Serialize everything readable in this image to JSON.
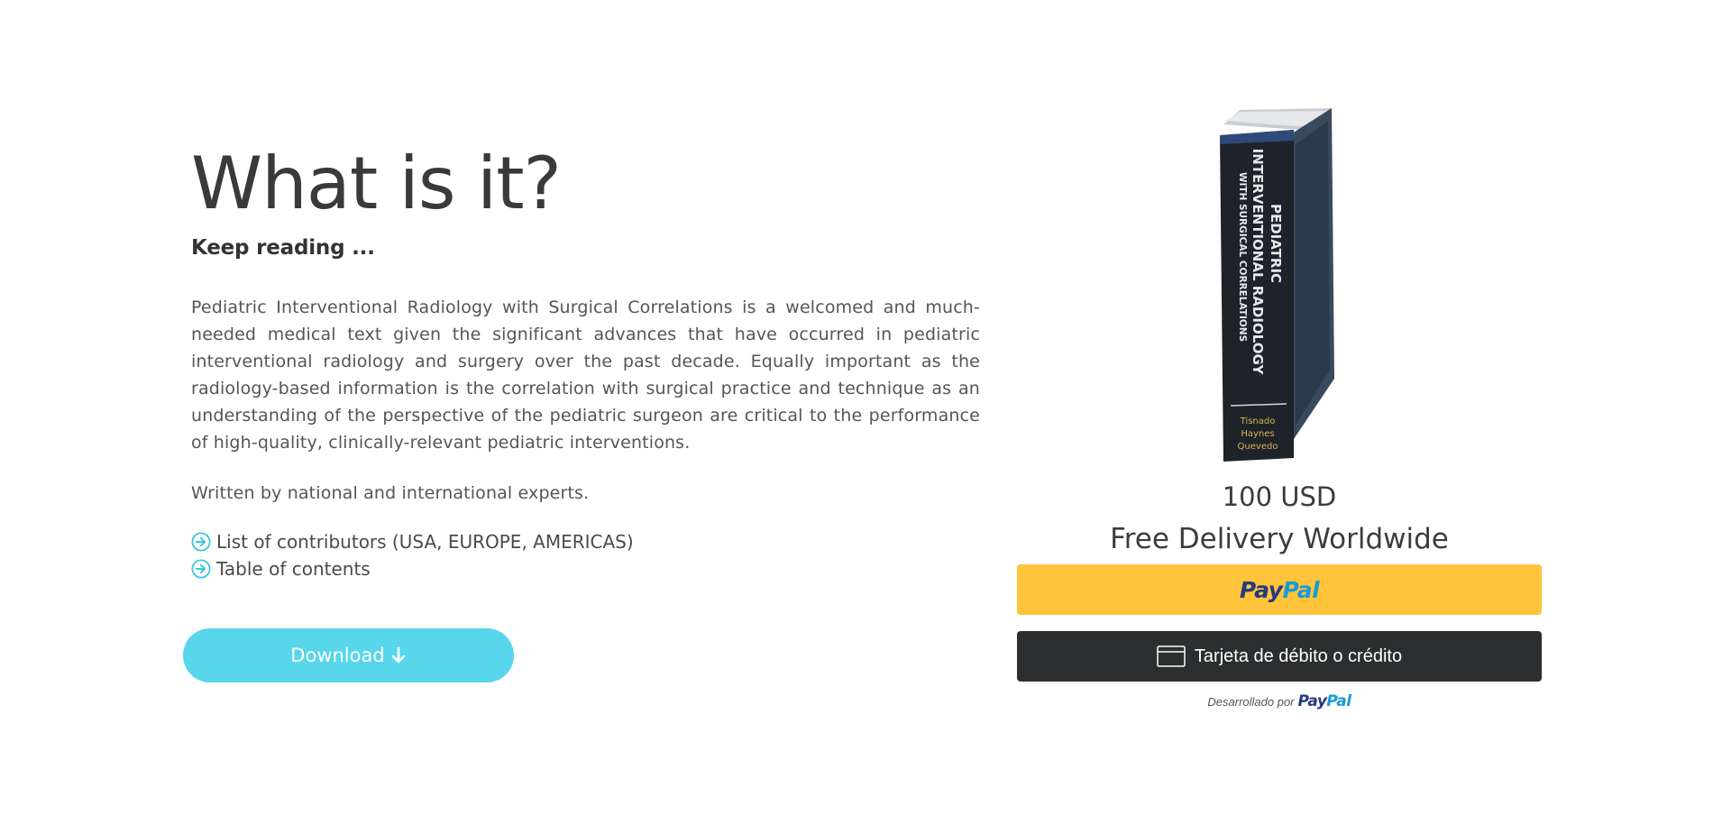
{
  "left": {
    "title": "What is it?",
    "subtitle": "Keep reading ...",
    "description": "Pediatric Interventional Radiology with Surgical Correlations is a welcomed and much-needed medical text given the significant advances that have occurred in pediatric interventional radiology and surgery over the past decade. Equally important as the radiology-based information is the correlation with surgical practice and technique as an understanding of the perspective of the pediatric surgeon are critical to the performance of high-quality, clinically-relevant pediatric interventions.",
    "experts": "Written by national and international experts.",
    "links": [
      {
        "label": "List of contributors (USA, EUROPE, AMERICAS)",
        "icon": "circle-arrow-right-icon"
      },
      {
        "label": "Table of contents",
        "icon": "circle-arrow-right-icon"
      }
    ],
    "download_label": "Download",
    "download_icon": "arrow-down-icon"
  },
  "book": {
    "spine_title_1": "PEDIATRIC",
    "spine_title_2": "INTERVENTIONAL RADIOLOGY",
    "spine_title_3": "WITH SURGICAL CORRELATIONS",
    "authors": [
      "Tisnado",
      "Haynes",
      "Quevedo"
    ]
  },
  "purchase": {
    "price": "100 USD",
    "delivery": "Free Delivery Worldwide",
    "paypal_pay": "Pay",
    "paypal_pal": "Pal",
    "card_label": "Tarjeta de débito o crédito",
    "powered_by": "Desarrollado por"
  },
  "colors": {
    "accent": "#57d6ec",
    "paypal_yellow": "#ffc439",
    "card_dark": "#2c2e2f",
    "paypal_dark_blue": "#253b80",
    "paypal_light_blue": "#179bd7"
  }
}
